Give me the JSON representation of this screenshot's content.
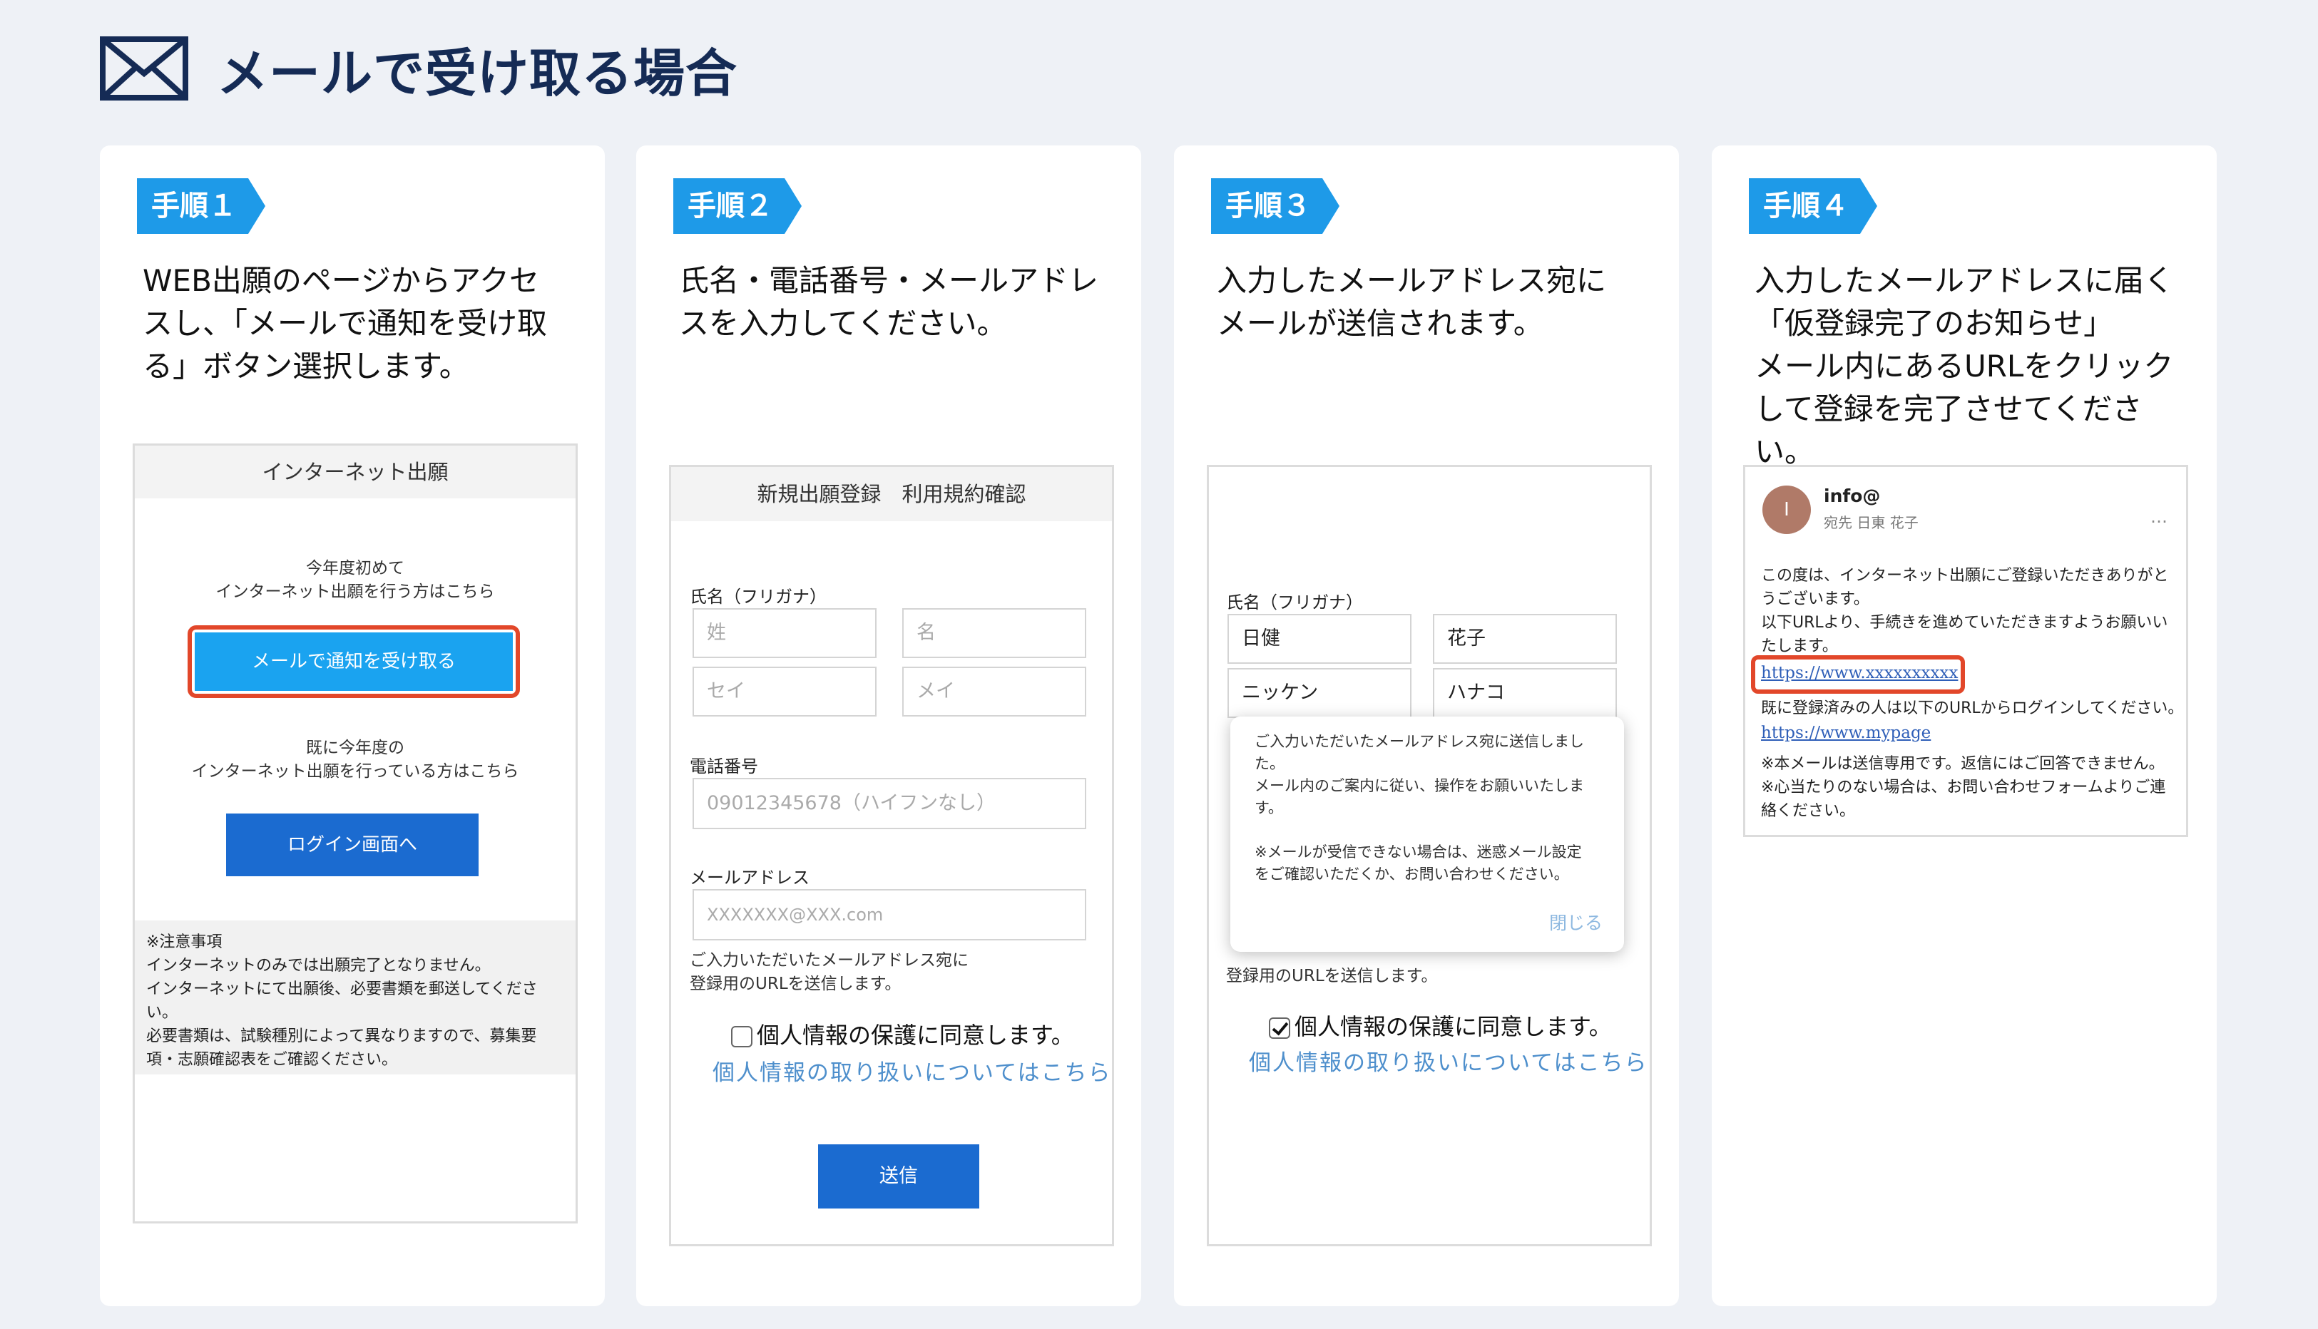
{
  "header": {
    "title": "メールで受け取る場合",
    "icon": "mail-icon"
  },
  "colors": {
    "accent": "#1e9ae8",
    "highlight": "#e2472a",
    "title": "#152b55"
  },
  "steps": [
    {
      "badge": "手順１",
      "text": [
        "WEB出願のページからアクセ",
        "スし、「メールで通知を受け取",
        "る」ボタン選択します。"
      ],
      "screen": {
        "title": "インターネット出願",
        "first_line1": "今年度初めて",
        "first_line2": "インターネット出願を行う方はこちら",
        "mail_button": "メールで通知を受け取る",
        "existing_line1": "既に今年度の",
        "existing_line2": "インターネット出願を行っている方はこちら",
        "login_button": "ログイン画面へ",
        "notes": [
          "※注意事項",
          "インターネットのみでは出願完了となりません。",
          "インターネットにて出願後、必要書類を郵送してくださ",
          "い。",
          "必要書類は、試験種別によって異なりますので、募集要",
          "項・志願確認表をご確認ください。"
        ]
      }
    },
    {
      "badge": "手順２",
      "text": [
        "氏名・電話番号・メールアドレ",
        "スを入力してください。"
      ],
      "screen": {
        "title": "新規出願登録　利用規約確認",
        "name_label": "氏名（フリガナ）",
        "sei_kanji": "姓",
        "mei_kanji": "名",
        "sei_kana": "セイ",
        "mei_kana": "メイ",
        "phone_label": "電話番号",
        "phone_placeholder": "09012345678（ハイフンなし）",
        "email_label": "メールアドレス",
        "email_placeholder": "XXXXXXX@XXX.com",
        "email_note1": "ご入力いただいたメールアドレス宛に",
        "email_note2": "登録用のURLを送信します。",
        "agree": "個人情報の保護に同意します。",
        "privacy_link": "個人情報の取り扱いについてはこちら",
        "submit": "送信"
      }
    },
    {
      "badge": "手順３",
      "text": [
        "入力したメールアドレス宛に",
        "メールが送信されます。"
      ],
      "screen": {
        "name_label": "氏名（フリガナ）",
        "sei_kanji": "日健",
        "mei_kanji": "花子",
        "sei_kana": "ニッケン",
        "mei_kana": "ハナコ",
        "popup_lines": [
          "ご入力いただいたメールアドレス宛に送信しまし",
          "た。",
          "メール内のご案内に従い、操作をお願いいたしま",
          "す。",
          "",
          "※メールが受信できない場合は、迷惑メール設定",
          "をご確認いただくか、お問い合わせください。"
        ],
        "close": "閉じる",
        "under_note": "登録用のURLを送信します。",
        "agree": "個人情報の保護に同意します。",
        "privacy_link": "個人情報の取り扱いについてはこちら"
      }
    },
    {
      "badge": "手順４",
      "text": [
        "入力したメールアドレスに届く",
        "「仮登録完了のお知らせ」",
        "メール内にあるURLをクリック",
        "して登録を完了させてください。"
      ],
      "screen": {
        "avatar": "I",
        "sender": "info@",
        "to": "宛先 日東 花子",
        "more": "…",
        "body1": [
          "この度は、インターネット出願にご登録いただきありがと",
          "うございます。",
          "以下URLより、手続きを進めていただきますようお願いい",
          "たします。"
        ],
        "link1": "https://www.xxxxxxxxxx",
        "body2": "既に登録済みの人は以下のURLからログインしてください。",
        "link2": "https://www.mypage",
        "body3": [
          "※本メールは送信専用です。返信にはご回答できません。",
          "※心当たりのない場合は、お問い合わせフォームよりご連",
          "絡ください。"
        ]
      }
    }
  ]
}
